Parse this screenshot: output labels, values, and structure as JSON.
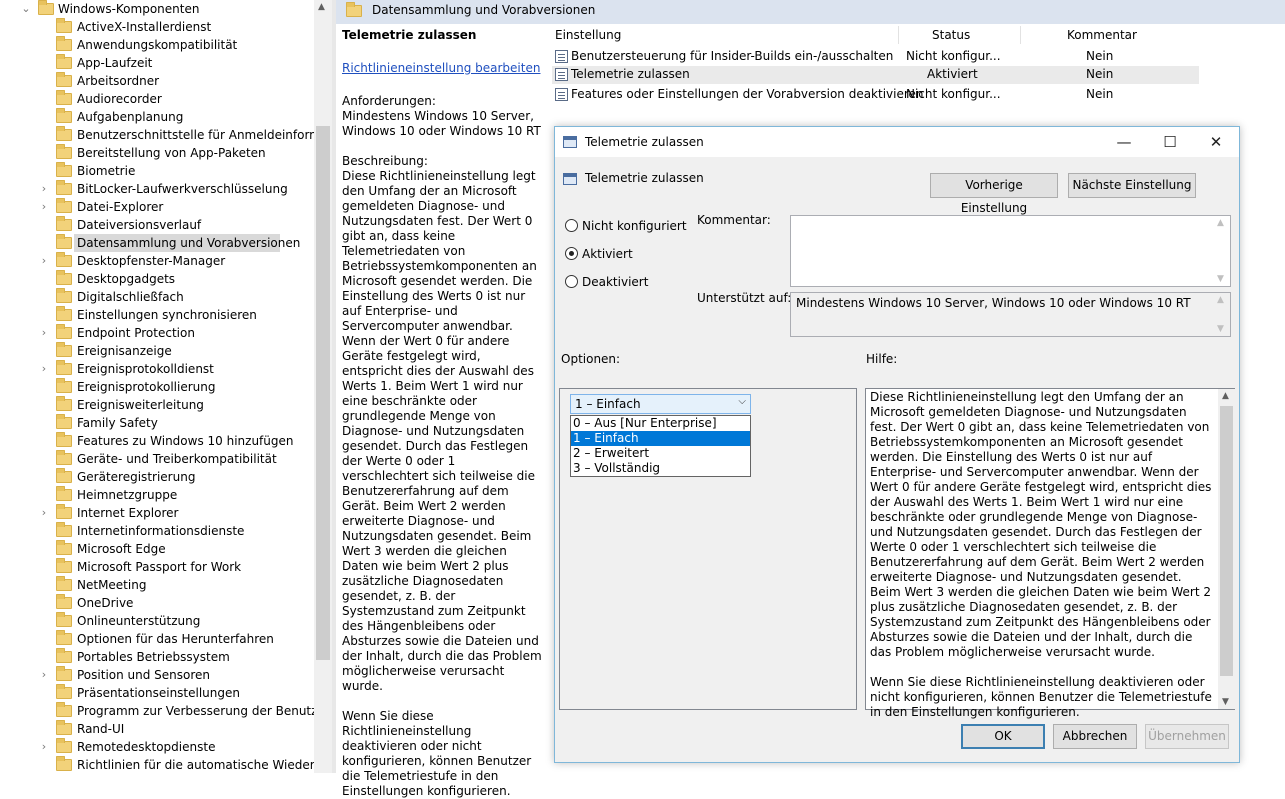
{
  "tree": {
    "root_label": "Windows-Komponenten",
    "items": [
      {
        "label": "ActiveX-Installerdienst",
        "expandable": false
      },
      {
        "label": "Anwendungskompatibilität",
        "expandable": false
      },
      {
        "label": "App-Laufzeit",
        "expandable": false
      },
      {
        "label": "Arbeitsordner",
        "expandable": false
      },
      {
        "label": "Audiorecorder",
        "expandable": false
      },
      {
        "label": "Aufgabenplanung",
        "expandable": false
      },
      {
        "label": "Benutzerschnittstelle für Anmeldeinformation",
        "expandable": false
      },
      {
        "label": "Bereitstellung von App-Paketen",
        "expandable": false
      },
      {
        "label": "Biometrie",
        "expandable": false
      },
      {
        "label": "BitLocker-Laufwerkverschlüsselung",
        "expandable": true
      },
      {
        "label": "Datei-Explorer",
        "expandable": true
      },
      {
        "label": "Dateiversionsverlauf",
        "expandable": false
      },
      {
        "label": "Datensammlung und Vorabversionen",
        "expandable": false,
        "selected": true
      },
      {
        "label": "Desktopfenster-Manager",
        "expandable": true
      },
      {
        "label": "Desktopgadgets",
        "expandable": false
      },
      {
        "label": "Digitalschließfach",
        "expandable": false
      },
      {
        "label": "Einstellungen synchronisieren",
        "expandable": false
      },
      {
        "label": "Endpoint Protection",
        "expandable": true
      },
      {
        "label": "Ereignisanzeige",
        "expandable": false
      },
      {
        "label": "Ereignisprotokolldienst",
        "expandable": true
      },
      {
        "label": "Ereignisprotokollierung",
        "expandable": false
      },
      {
        "label": "Ereignisweiterleitung",
        "expandable": false
      },
      {
        "label": "Family Safety",
        "expandable": false
      },
      {
        "label": "Features zu Windows 10 hinzufügen",
        "expandable": false
      },
      {
        "label": "Geräte- und Treiberkompatibilität",
        "expandable": false
      },
      {
        "label": "Geräteregistrierung",
        "expandable": false
      },
      {
        "label": "Heimnetzgruppe",
        "expandable": false
      },
      {
        "label": "Internet Explorer",
        "expandable": true
      },
      {
        "label": "Internetinformationsdienste",
        "expandable": false
      },
      {
        "label": "Microsoft Edge",
        "expandable": false
      },
      {
        "label": "Microsoft Passport for Work",
        "expandable": false
      },
      {
        "label": "NetMeeting",
        "expandable": false
      },
      {
        "label": "OneDrive",
        "expandable": false
      },
      {
        "label": "Onlineunterstützung",
        "expandable": false
      },
      {
        "label": "Optionen für das Herunterfahren",
        "expandable": false
      },
      {
        "label": "Portables Betriebssystem",
        "expandable": false
      },
      {
        "label": "Position und Sensoren",
        "expandable": true
      },
      {
        "label": "Präsentationseinstellungen",
        "expandable": false
      },
      {
        "label": "Programm zur Verbesserung der Benutzerfreu",
        "expandable": false
      },
      {
        "label": "Rand-UI",
        "expandable": false
      },
      {
        "label": "Remotedesktopdienste",
        "expandable": true
      },
      {
        "label": "Richtlinien für die automatische Wiedergabe",
        "expandable": false
      }
    ]
  },
  "header": {
    "title": "Datensammlung und Vorabversionen"
  },
  "description": {
    "title": "Telemetrie zulassen",
    "edit_link": "Richtlinieneinstellung bearbeiten",
    "requirements": "Anforderungen:\nMindestens Windows 10 Server, Windows 10 oder Windows 10 RT",
    "body": "Beschreibung:\nDiese Richtlinieneinstellung legt den Umfang der an Microsoft gemeldeten Diagnose- und Nutzungsdaten fest. Der Wert 0 gibt an, dass keine Telemetriedaten von Betriebssystemkomponenten an Microsoft gesendet werden. Die Einstellung des Werts 0 ist nur auf Enterprise- und Servercomputer anwendbar. Wenn der Wert 0 für andere Geräte festgelegt wird, entspricht dies der Auswahl des Werts 1. Beim Wert 1 wird nur eine beschränkte oder grundlegende Menge von Diagnose- und Nutzungsdaten gesendet. Durch das Festlegen der Werte 0 oder 1 verschlechtert sich teilweise die Benutzererfahrung auf dem Gerät. Beim Wert 2 werden erweiterte Diagnose- und Nutzungsdaten gesendet. Beim Wert 3 werden die gleichen Daten wie beim Wert 2 plus zusätzliche Diagnosedaten gesendet, z. B. der Systemzustand zum Zeitpunkt des Hängenbleibens oder Absturzes sowie die Dateien und der Inhalt, durch die das Problem möglicherweise verursacht wurde.",
    "footer": "Wenn Sie diese Richtlinieneinstellung deaktivieren oder nicht konfigurieren, können Benutzer die Telemetriestufe in den Einstellungen konfigurieren."
  },
  "settings_list": {
    "columns": [
      "Einstellung",
      "Status",
      "Kommentar"
    ],
    "rows": [
      {
        "name": "Benutzersteuerung für Insider-Builds ein-/ausschalten",
        "status": "Nicht konfigur...",
        "comment": "Nein"
      },
      {
        "name": "Telemetrie zulassen",
        "status": "Aktiviert",
        "comment": "Nein"
      },
      {
        "name": "Features oder Einstellungen der Vorabversion deaktivieren",
        "status": "Nicht konfigur...",
        "comment": "Nein"
      }
    ]
  },
  "dialog": {
    "title": "Telemetrie zulassen",
    "subtitle": "Telemetrie zulassen",
    "prev_button": "Vorherige Einstellung",
    "next_button": "Nächste Einstellung",
    "radios": [
      {
        "label": "Nicht konfiguriert",
        "checked": false
      },
      {
        "label": "Aktiviert",
        "checked": true
      },
      {
        "label": "Deaktiviert",
        "checked": false
      }
    ],
    "comment_label": "Kommentar:",
    "comment_value": "",
    "supported_label": "Unterstützt auf:",
    "supported_value": "Mindestens Windows 10 Server, Windows 10 oder Windows 10 RT",
    "options_label": "Optionen:",
    "help_label": "Hilfe:",
    "combo_value": "1 – Einfach",
    "combo_options": [
      "0 – Aus [Nur Enterprise]",
      "1 – Einfach",
      "2 – Erweitert",
      "3 – Vollständig"
    ],
    "combo_selected_index": 1,
    "help_text": "Diese Richtlinieneinstellung legt den Umfang der an Microsoft gemeldeten Diagnose- und Nutzungsdaten fest. Der Wert 0 gibt an, dass keine Telemetriedaten von Betriebssystemkomponenten an Microsoft gesendet werden. Die Einstellung des Werts 0 ist nur auf Enterprise- und Servercomputer anwendbar. Wenn der Wert 0 für andere Geräte festgelegt wird, entspricht dies der Auswahl des Werts 1. Beim Wert 1 wird nur eine beschränkte oder grundlegende Menge von Diagnose- und Nutzungsdaten gesendet. Durch das Festlegen der Werte 0 oder 1 verschlechtert sich teilweise die Benutzererfahrung auf dem Gerät. Beim Wert 2 werden erweiterte Diagnose- und Nutzungsdaten gesendet. Beim Wert 3 werden die gleichen Daten wie beim Wert 2 plus zusätzliche Diagnosedaten gesendet, z. B. der Systemzustand zum Zeitpunkt des Hängenbleibens oder Absturzes sowie die Dateien und der Inhalt, durch die das Problem möglicherweise verursacht wurde.\n\nWenn Sie diese Richtlinieneinstellung deaktivieren oder nicht konfigurieren, können Benutzer die Telemetriestufe in den Einstellungen konfigurieren.",
    "ok_button": "OK",
    "cancel_button": "Abbrechen",
    "apply_button": "Übernehmen"
  }
}
